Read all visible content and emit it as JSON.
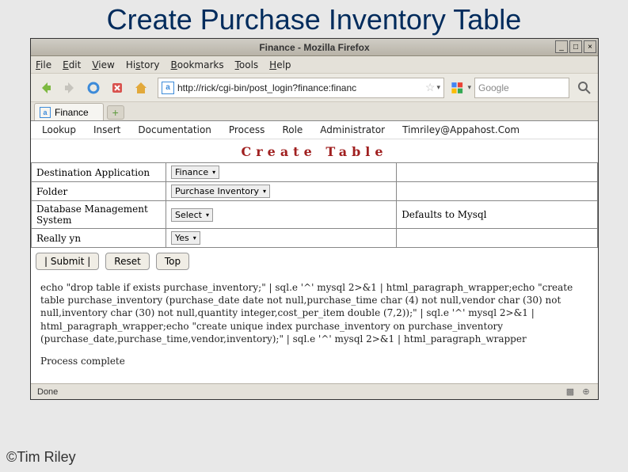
{
  "slide_title": "Create Purchase Inventory Table",
  "window": {
    "title": "Finance - Mozilla Firefox"
  },
  "menubar": {
    "file": "File",
    "edit": "Edit",
    "view": "View",
    "history": "History",
    "bookmarks": "Bookmarks",
    "tools": "Tools",
    "help": "Help"
  },
  "toolbar": {
    "url": "http://rick/cgi-bin/post_login?finance:financ",
    "favicon_letter": "a",
    "search_placeholder": "Google"
  },
  "tab": {
    "label": "Finance",
    "favicon": "a"
  },
  "app_menu": [
    "Lookup",
    "Insert",
    "Documentation",
    "Process",
    "Role",
    "Administrator",
    "Timriley@Appahost.Com"
  ],
  "page_heading": "Create Table",
  "form": {
    "rows": [
      {
        "label": "Destination Application",
        "value": "Finance",
        "extra": ""
      },
      {
        "label": "Folder",
        "value": "Purchase Inventory",
        "extra": ""
      },
      {
        "label": "Database Management System",
        "value": "Select",
        "extra": "Defaults to Mysql"
      },
      {
        "label": "Really yn",
        "value": "Yes",
        "extra": ""
      }
    ]
  },
  "buttons": {
    "submit": "|   Submit   |",
    "reset": "Reset",
    "top": "Top"
  },
  "output": {
    "sql": "echo \"drop table if exists purchase_inventory;\" | sql.e '^' mysql 2>&1 | html_paragraph_wrapper;echo \"create table purchase_inventory (purchase_date date not null,purchase_time char (4) not null,vendor char (30) not null,inventory char (30) not null,quantity integer,cost_per_item double (7,2));\" | sql.e '^' mysql 2>&1 | html_paragraph_wrapper;echo \"create unique index purchase_inventory on purchase_inventory (purchase_date,purchase_time,vendor,inventory);\" | sql.e '^' mysql 2>&1 | html_paragraph_wrapper",
    "status": "Process complete"
  },
  "statusbar": {
    "text": "Done"
  },
  "footer": "©Tim Riley"
}
